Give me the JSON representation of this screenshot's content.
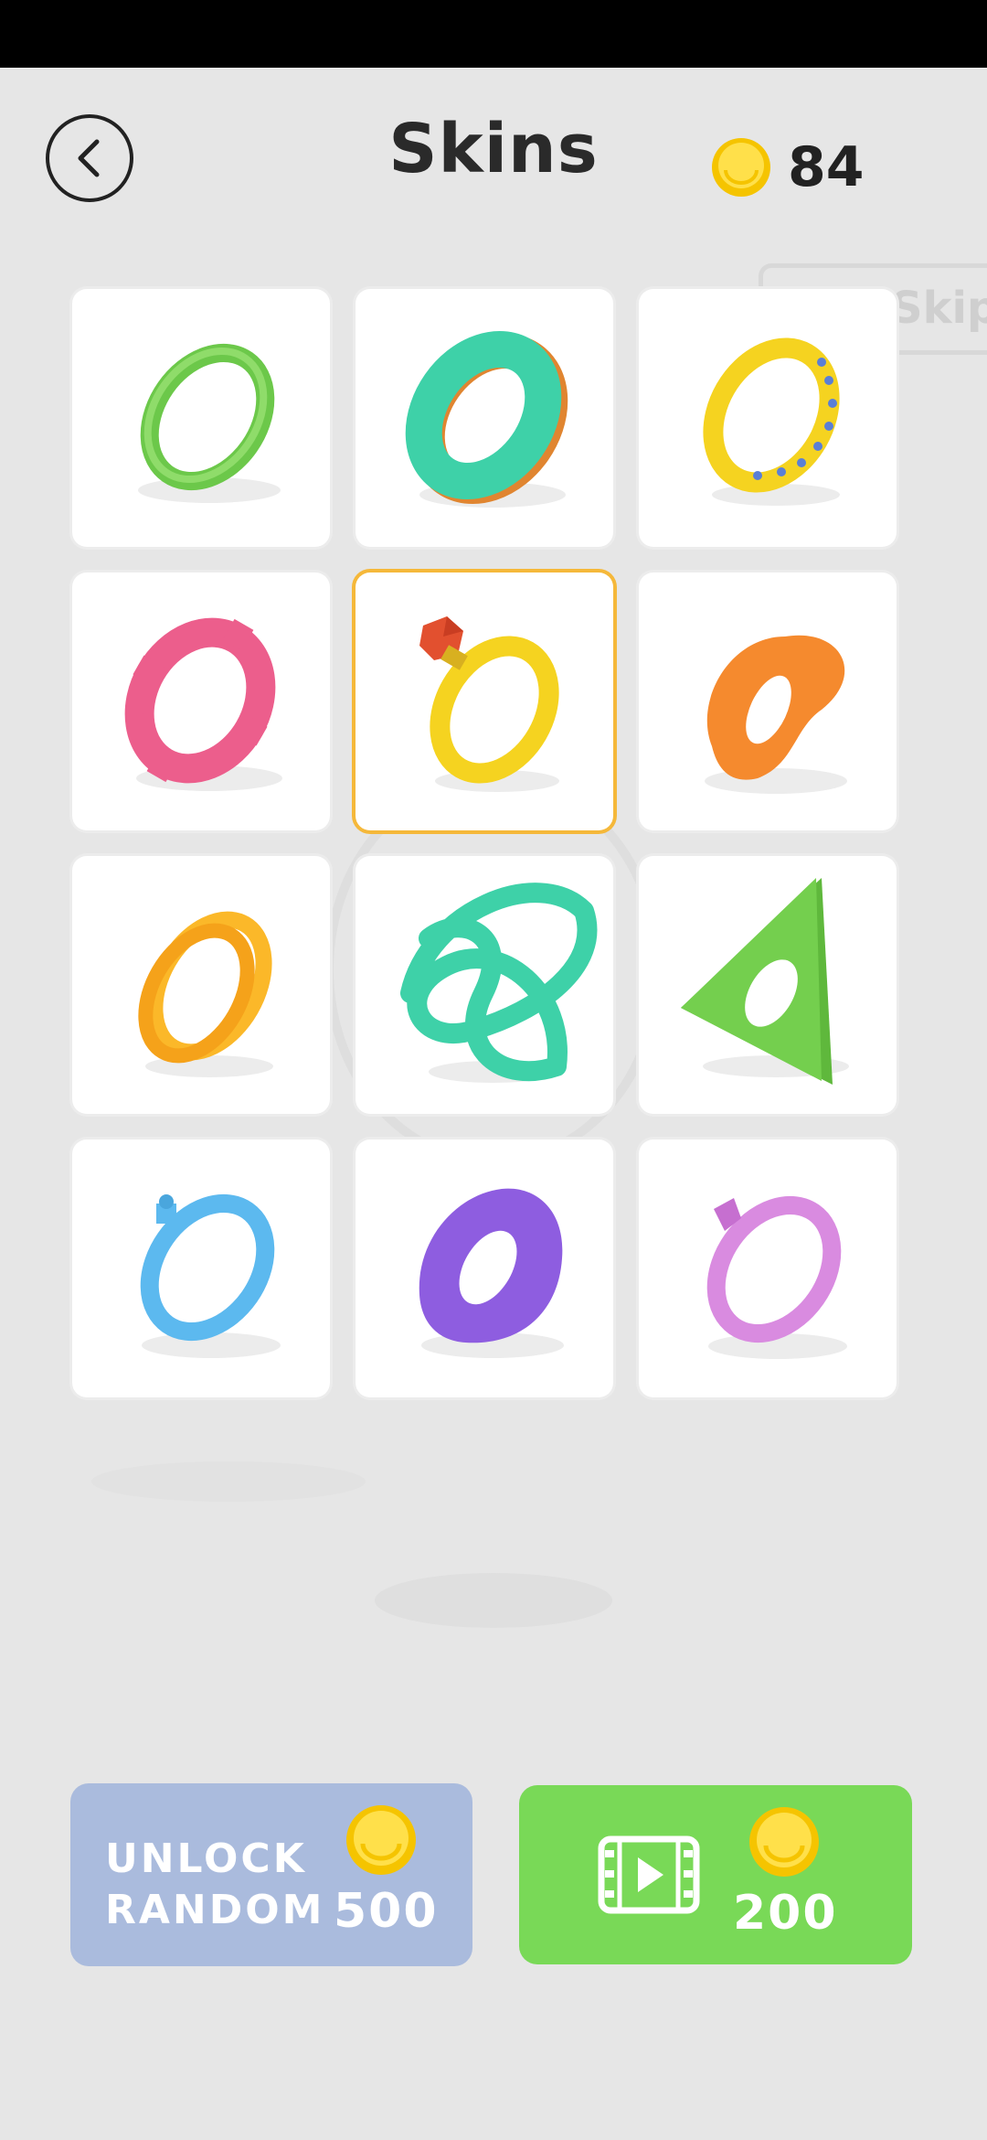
{
  "header": {
    "title": "Skins",
    "coins": "84",
    "back_icon": "chevron-left-icon",
    "coin_icon": "coin-icon"
  },
  "skip": {
    "label": "Skip"
  },
  "skins": [
    {
      "name": "green-ring",
      "color": "#6cc84a"
    },
    {
      "name": "teal-donut",
      "color": "#3ed1a8"
    },
    {
      "name": "yellow-studded-ring",
      "color": "#f5d320"
    },
    {
      "name": "pink-gear",
      "color": "#ec5e8c"
    },
    {
      "name": "yellow-gem-ring",
      "color": "#f5d320",
      "selected": true
    },
    {
      "name": "orange-blob",
      "color": "#f58a2e"
    },
    {
      "name": "orange-double-ring",
      "color": "#fbb829"
    },
    {
      "name": "teal-knot",
      "color": "#3ed1a8"
    },
    {
      "name": "green-triangle",
      "color": "#6cc84a"
    },
    {
      "name": "blue-ring",
      "color": "#5cb9ef"
    },
    {
      "name": "purple-square-ring",
      "color": "#8e5de0"
    },
    {
      "name": "lilac-ring",
      "color": "#d98be0"
    }
  ],
  "buttons": {
    "unlock_random": {
      "label_line1": "UNLOCK",
      "label_line2": "RANDOM",
      "price": "500"
    },
    "watch_video": {
      "price": "200",
      "icon": "video-icon"
    }
  },
  "colors": {
    "background": "#e6e6e6",
    "unlock_button": "#aabbdd",
    "video_button": "#79d957",
    "selected_border": "#f5b83a",
    "coin": "#ffd500"
  }
}
